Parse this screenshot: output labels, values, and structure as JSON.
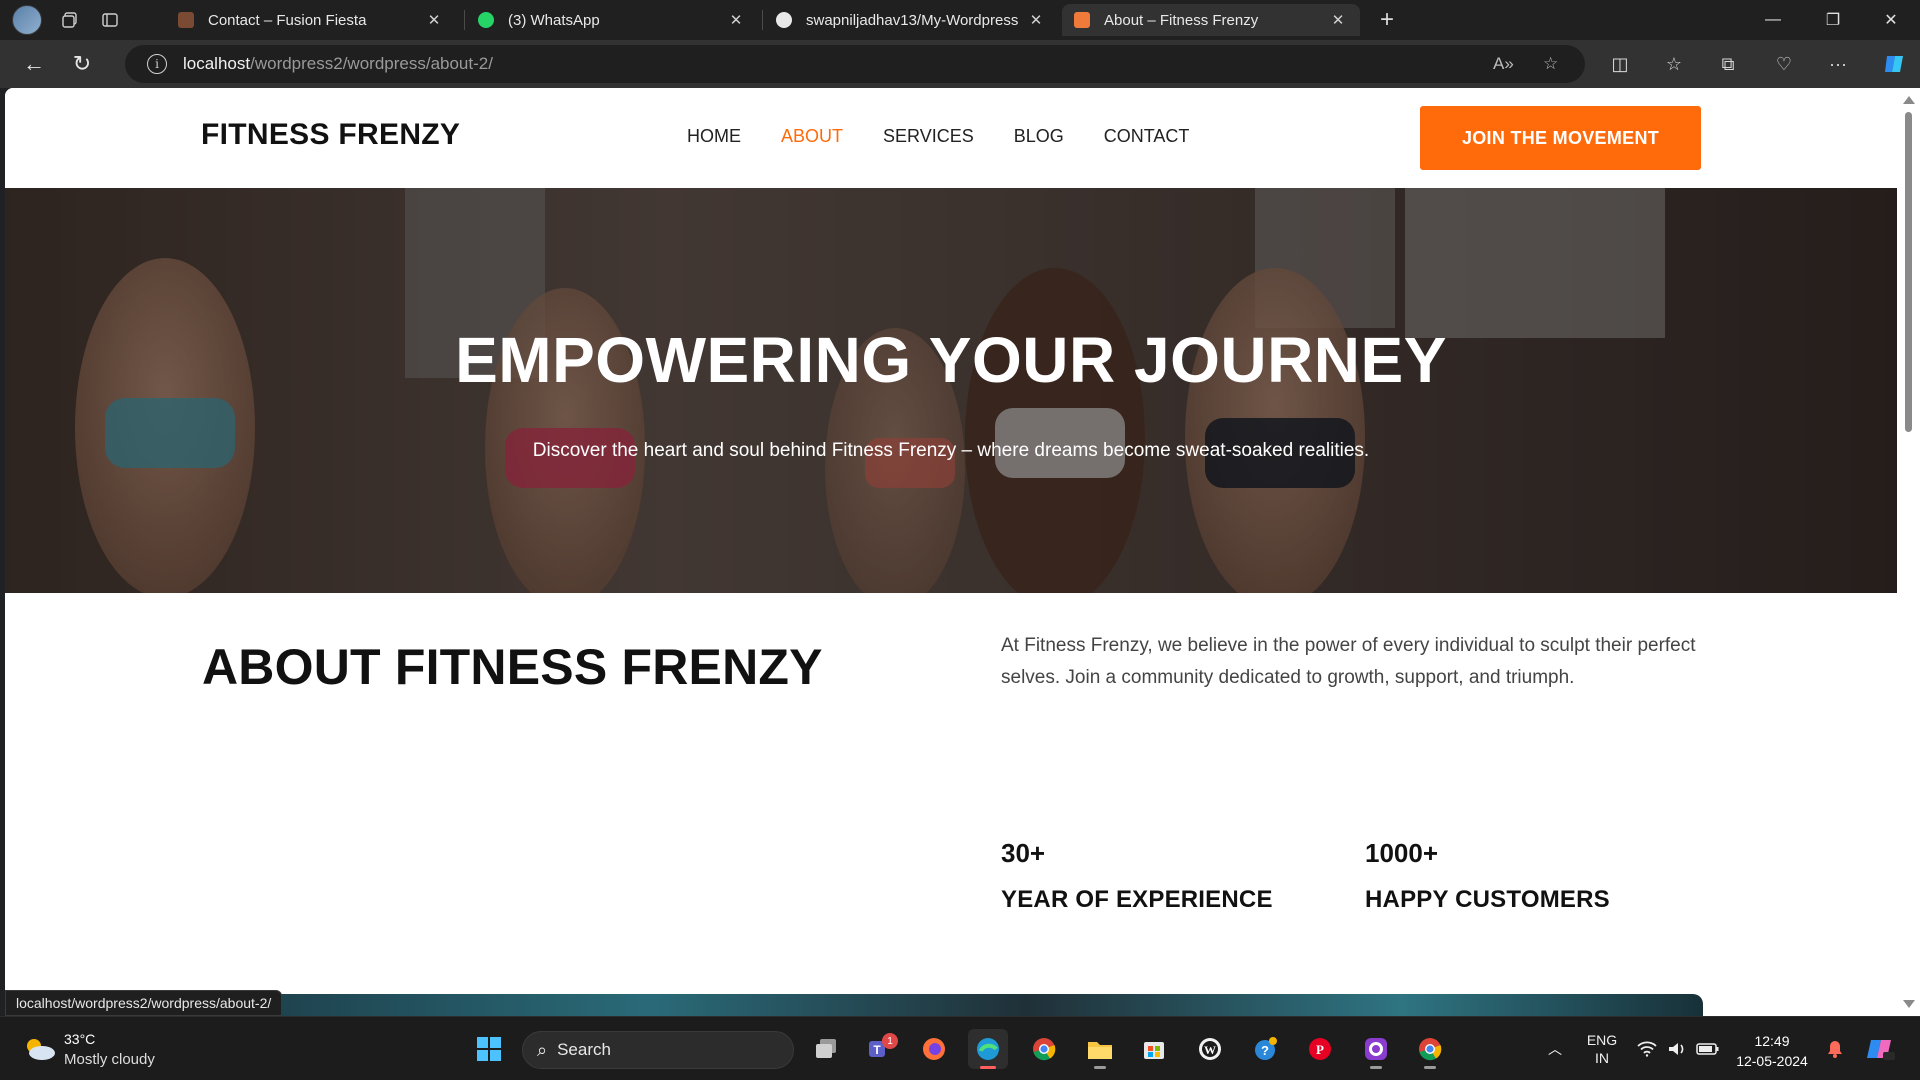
{
  "browser": {
    "tabs": [
      {
        "title": "Contact – Fusion Fiesta",
        "active": false
      },
      {
        "title": "(3) WhatsApp",
        "active": false
      },
      {
        "title": "swapniljadhav13/My-Wordpress",
        "active": false
      },
      {
        "title": "About – Fitness Frenzy",
        "active": true
      }
    ],
    "url_host": "localhost",
    "url_path": "/wordpress2/wordpress/about-2/",
    "status_url": "localhost/wordpress2/wordpress/about-2/"
  },
  "site": {
    "logo": "FITNESS FRENZY",
    "nav": [
      "HOME",
      "ABOUT",
      "SERVICES",
      "BLOG",
      "CONTACT"
    ],
    "nav_current": "ABOUT",
    "cta": "JOIN THE MOVEMENT",
    "accent_color": "#ff6b0b"
  },
  "hero": {
    "title": "EMPOWERING YOUR JOURNEY",
    "subtitle": "Discover the heart and soul behind Fitness Frenzy – where dreams become sweat-soaked realities."
  },
  "about": {
    "title": "ABOUT FITNESS FRENZY",
    "text": "At Fitness Frenzy, we believe in the power of every individual to sculpt their perfect selves. Join a community dedicated to growth, support, and triumph.",
    "stats": [
      {
        "value": "30+",
        "label": "YEAR OF EXPERIENCE"
      },
      {
        "value": "1000+",
        "label": "HAPPY CUSTOMERS"
      }
    ]
  },
  "taskbar": {
    "weather_temp": "33°C",
    "weather_desc": "Mostly cloudy",
    "search_label": "Search",
    "lang_line1": "ENG",
    "lang_line2": "IN",
    "time": "12:49",
    "date": "12-05-2024",
    "teams_badge": "1"
  }
}
